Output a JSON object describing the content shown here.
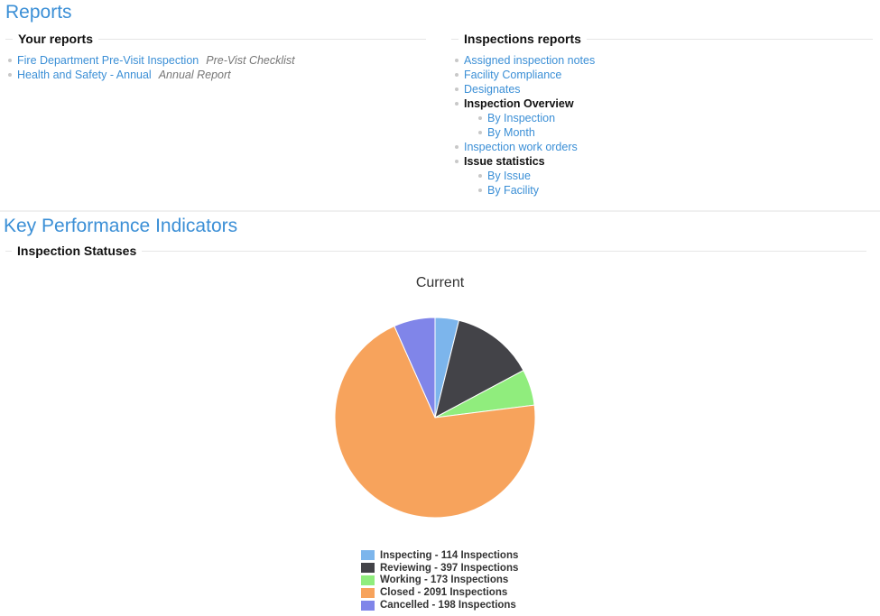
{
  "reports": {
    "title": "Reports",
    "your_reports": {
      "heading": "Your reports",
      "items": [
        {
          "label": "Fire Department Pre-Visit Inspection",
          "description": "Pre-Vist Checklist"
        },
        {
          "label": "Health and Safety - Annual",
          "description": "Annual Report"
        }
      ]
    },
    "inspections_reports": {
      "heading": "Inspections reports",
      "items": [
        {
          "label": "Assigned inspection notes"
        },
        {
          "label": "Facility Compliance"
        },
        {
          "label": "Designates"
        },
        {
          "label": "Inspection Overview",
          "children": [
            {
              "label": "By Inspection"
            },
            {
              "label": "By Month"
            }
          ]
        },
        {
          "label": "Inspection work orders"
        },
        {
          "label": "Issue statistics",
          "children": [
            {
              "label": "By Issue"
            },
            {
              "label": "By Facility"
            }
          ]
        }
      ]
    }
  },
  "kpi": {
    "title": "Key Performance Indicators",
    "section_heading": "Inspection Statuses"
  },
  "chart_data": {
    "type": "pie",
    "title": "Current",
    "categories": [
      "Inspecting",
      "Reviewing",
      "Working",
      "Closed",
      "Cancelled"
    ],
    "values": [
      114,
      397,
      173,
      2091,
      198
    ],
    "unit": "Inspections",
    "colors": [
      "#7cb5ec",
      "#434348",
      "#90ed7d",
      "#f7a35c",
      "#8085e9"
    ],
    "legend_labels": [
      "Inspecting - 114 Inspections",
      "Reviewing - 397 Inspections",
      "Working - 173 Inspections",
      "Closed - 2091 Inspections",
      "Cancelled - 198 Inspections"
    ],
    "legend_position": "bottom"
  }
}
